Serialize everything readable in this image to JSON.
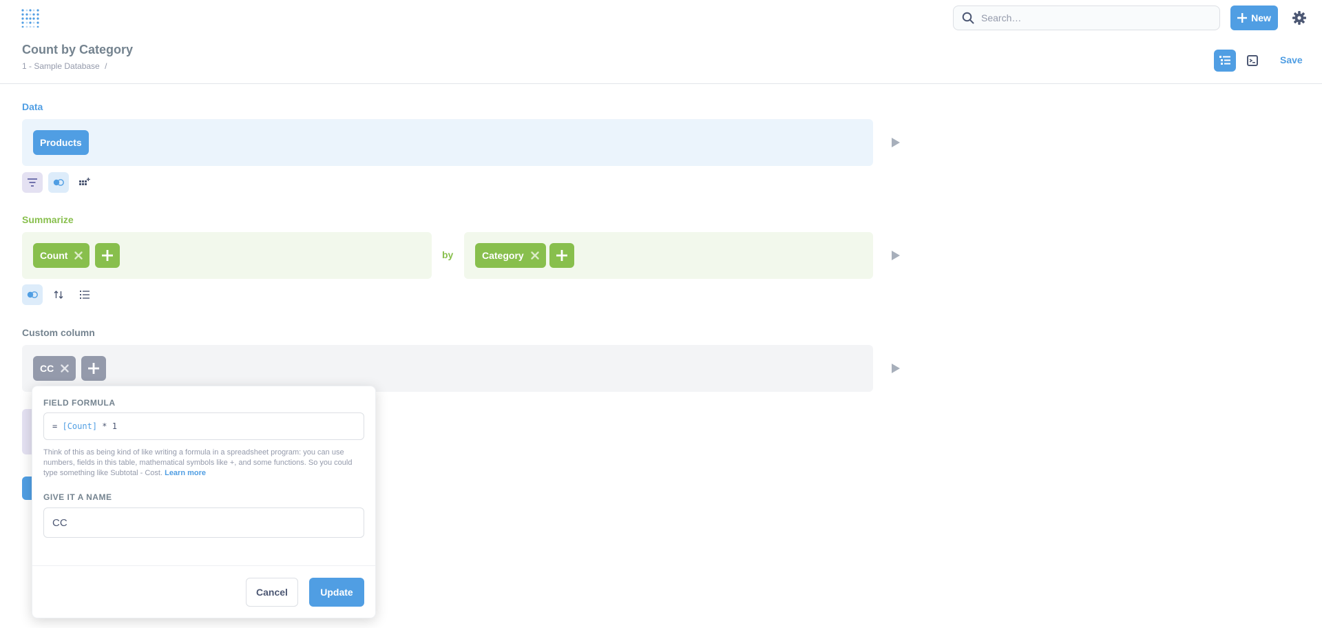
{
  "topbar": {
    "search_placeholder": "Search…",
    "new_label": "New"
  },
  "header": {
    "title": "Count by Category",
    "breadcrumb": "1 - Sample Database",
    "breadcrumb_sep": "/",
    "save_label": "Save"
  },
  "data_section": {
    "label": "Data",
    "table_pill": "Products"
  },
  "summarize_section": {
    "label": "Summarize",
    "metric_pill": "Count",
    "by_label": "by",
    "breakout_pill": "Category"
  },
  "custom_column_section": {
    "label": "Custom column",
    "column_pill": "CC"
  },
  "popover": {
    "formula_label": "FIELD FORMULA",
    "formula_prefix": "=",
    "formula_ref": "[Count]",
    "formula_rest": "* 1",
    "help_text": "Think of this as being kind of like writing a formula in a spreadsheet program: you can use numbers, fields in this table, mathematical symbols like +, and some functions. So you could type something like Subtotal - Cost.",
    "learn_more": "Learn more",
    "name_label": "GIVE IT A NAME",
    "name_value": "CC",
    "cancel_label": "Cancel",
    "update_label": "Update"
  },
  "colors": {
    "brand": "#509ee3",
    "data_bg": "#ebf4fc",
    "summarize": "#88bf4d",
    "summarize_bg": "#f2f8ec",
    "custom": "#949aab",
    "custom_bg": "#f3f4f6",
    "filter_tool_bg": "#e4e1f2"
  },
  "icons": {
    "logo": "metabase-logo-icon",
    "search": "search-icon",
    "new": "plus-icon",
    "settings": "gear-icon",
    "notebook": "notebook-icon",
    "visualization": "visualization-icon",
    "filter": "filter-icon",
    "join": "join-icon",
    "custom": "custom-column-icon",
    "sort": "sort-icon",
    "limit": "list-icon",
    "run": "play-icon",
    "remove": "close-icon"
  }
}
